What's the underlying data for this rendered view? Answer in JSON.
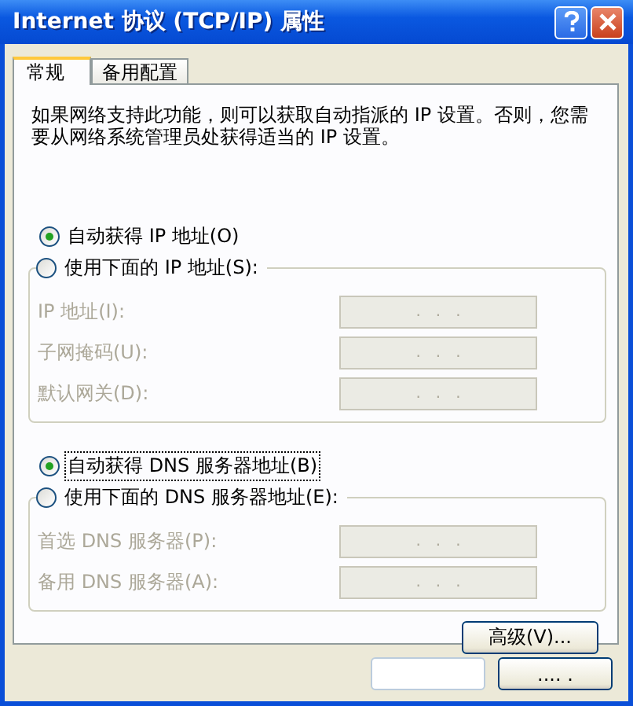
{
  "window": {
    "title": "Internet 协议 (TCP/IP) 属性"
  },
  "tabs": [
    {
      "label": "常规",
      "selected": true
    },
    {
      "label": "备用配置",
      "selected": false
    }
  ],
  "description": "如果网络支持此功能，则可以获取自动指派的 IP 设置。否则，您需要从网络系统管理员处获得适当的 IP 设置。",
  "sections": [
    {
      "options": [
        {
          "label": "自动获得 IP 地址(O)",
          "selected": true,
          "focused": false
        },
        {
          "label": "使用下面的 IP 地址(S):",
          "selected": false,
          "focused": false
        }
      ],
      "fields": [
        {
          "label": "IP 地址(I):",
          "value": ".   .   .",
          "disabled": true
        },
        {
          "label": "子网掩码(U):",
          "value": ".   .   .",
          "disabled": true
        },
        {
          "label": "默认网关(D):",
          "value": ".   .   .",
          "disabled": true
        }
      ]
    },
    {
      "options": [
        {
          "label": "自动获得 DNS 服务器地址(B)",
          "selected": true,
          "focused": true
        },
        {
          "label": "使用下面的 DNS 服务器地址(E):",
          "selected": false,
          "focused": false
        }
      ],
      "fields": [
        {
          "label": "首选 DNS 服务器(P):",
          "value": ".   .   .",
          "disabled": true
        },
        {
          "label": "备用 DNS 服务器(A):",
          "value": ".   .   .",
          "disabled": true
        }
      ]
    }
  ],
  "advanced_button": "高级(V)...",
  "dialog_buttons": [
    {
      "kind": "blank"
    },
    {
      "kind": "text",
      "label": ".... ."
    }
  ]
}
